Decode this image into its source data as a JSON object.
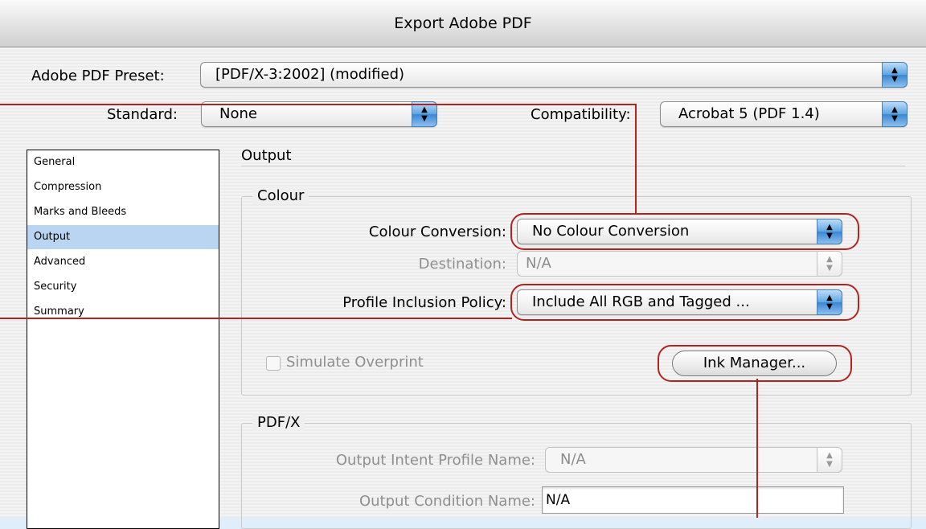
{
  "window": {
    "title": "Export Adobe PDF"
  },
  "preset": {
    "label": "Adobe PDF Preset:",
    "value": "[PDF/X-3:2002] (modified)"
  },
  "standard": {
    "label": "Standard:",
    "value": "None"
  },
  "compatibility": {
    "label": "Compatibility:",
    "value": "Acrobat 5 (PDF 1.4)"
  },
  "sidebar": {
    "items": [
      {
        "label": "General"
      },
      {
        "label": "Compression"
      },
      {
        "label": "Marks and Bleeds"
      },
      {
        "label": "Output",
        "selected": true
      },
      {
        "label": "Advanced"
      },
      {
        "label": "Security"
      },
      {
        "label": "Summary"
      }
    ]
  },
  "panel": {
    "title": "Output"
  },
  "colour": {
    "group_title": "Colour",
    "conversion_label": "Colour Conversion:",
    "conversion_value": "No Colour Conversion",
    "destination_label": "Destination:",
    "destination_value": "N/A",
    "profile_label": "Profile Inclusion Policy:",
    "profile_value": "Include All RGB and Tagged ...",
    "simulate_label": "Simulate Overprint",
    "ink_manager_label": "Ink Manager..."
  },
  "pdfx": {
    "group_title": "PDF/X",
    "intent_label": "Output Intent Profile Name:",
    "intent_value": "N/A",
    "condition_label": "Output Condition Name:",
    "condition_value": "N/A"
  },
  "colors": {
    "annotation": "#b0251e",
    "selection": "#b9d5f1",
    "popup_arrow": "#3a86d2"
  },
  "icons": {
    "popup_arrows": "up-down-arrows-icon"
  }
}
